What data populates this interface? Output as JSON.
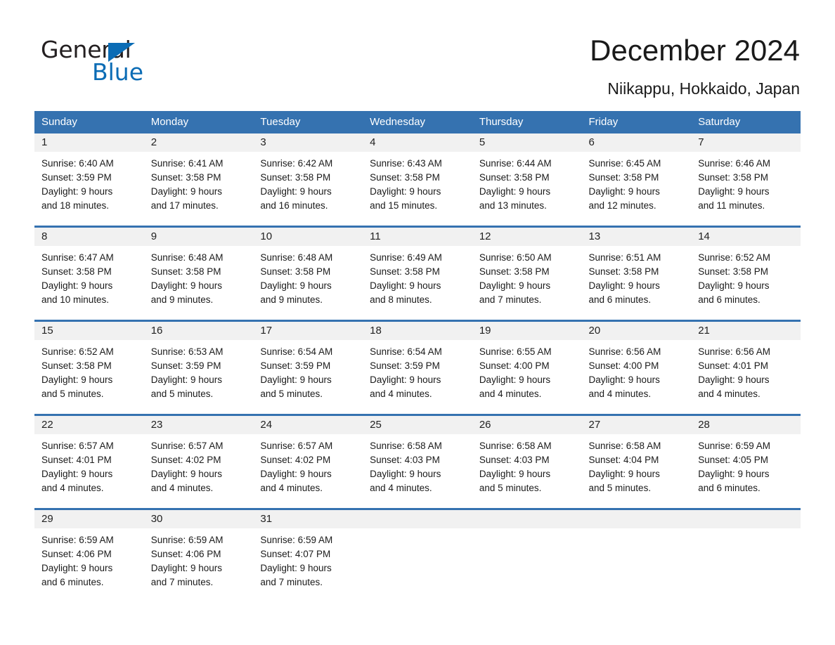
{
  "brand": {
    "name_part1": "General",
    "name_part2": "Blue",
    "triangle_icon": "blue-triangle-icon",
    "accent_color": "#0b6cb5"
  },
  "header": {
    "title": "December 2024",
    "subtitle": "Niikappu, Hokkaido, Japan"
  },
  "theme": {
    "header_blue": "#3572b0",
    "daynum_band_gray": "#f1f1f1",
    "text": "#1a1a1a"
  },
  "calendar": {
    "weekday_headers": [
      "Sunday",
      "Monday",
      "Tuesday",
      "Wednesday",
      "Thursday",
      "Friday",
      "Saturday"
    ],
    "weeks": [
      [
        {
          "day": "1",
          "sunrise": "Sunrise: 6:40 AM",
          "sunset": "Sunset: 3:59 PM",
          "daylight_line1": "Daylight: 9 hours",
          "daylight_line2": "and 18 minutes."
        },
        {
          "day": "2",
          "sunrise": "Sunrise: 6:41 AM",
          "sunset": "Sunset: 3:58 PM",
          "daylight_line1": "Daylight: 9 hours",
          "daylight_line2": "and 17 minutes."
        },
        {
          "day": "3",
          "sunrise": "Sunrise: 6:42 AM",
          "sunset": "Sunset: 3:58 PM",
          "daylight_line1": "Daylight: 9 hours",
          "daylight_line2": "and 16 minutes."
        },
        {
          "day": "4",
          "sunrise": "Sunrise: 6:43 AM",
          "sunset": "Sunset: 3:58 PM",
          "daylight_line1": "Daylight: 9 hours",
          "daylight_line2": "and 15 minutes."
        },
        {
          "day": "5",
          "sunrise": "Sunrise: 6:44 AM",
          "sunset": "Sunset: 3:58 PM",
          "daylight_line1": "Daylight: 9 hours",
          "daylight_line2": "and 13 minutes."
        },
        {
          "day": "6",
          "sunrise": "Sunrise: 6:45 AM",
          "sunset": "Sunset: 3:58 PM",
          "daylight_line1": "Daylight: 9 hours",
          "daylight_line2": "and 12 minutes."
        },
        {
          "day": "7",
          "sunrise": "Sunrise: 6:46 AM",
          "sunset": "Sunset: 3:58 PM",
          "daylight_line1": "Daylight: 9 hours",
          "daylight_line2": "and 11 minutes."
        }
      ],
      [
        {
          "day": "8",
          "sunrise": "Sunrise: 6:47 AM",
          "sunset": "Sunset: 3:58 PM",
          "daylight_line1": "Daylight: 9 hours",
          "daylight_line2": "and 10 minutes."
        },
        {
          "day": "9",
          "sunrise": "Sunrise: 6:48 AM",
          "sunset": "Sunset: 3:58 PM",
          "daylight_line1": "Daylight: 9 hours",
          "daylight_line2": "and 9 minutes."
        },
        {
          "day": "10",
          "sunrise": "Sunrise: 6:48 AM",
          "sunset": "Sunset: 3:58 PM",
          "daylight_line1": "Daylight: 9 hours",
          "daylight_line2": "and 9 minutes."
        },
        {
          "day": "11",
          "sunrise": "Sunrise: 6:49 AM",
          "sunset": "Sunset: 3:58 PM",
          "daylight_line1": "Daylight: 9 hours",
          "daylight_line2": "and 8 minutes."
        },
        {
          "day": "12",
          "sunrise": "Sunrise: 6:50 AM",
          "sunset": "Sunset: 3:58 PM",
          "daylight_line1": "Daylight: 9 hours",
          "daylight_line2": "and 7 minutes."
        },
        {
          "day": "13",
          "sunrise": "Sunrise: 6:51 AM",
          "sunset": "Sunset: 3:58 PM",
          "daylight_line1": "Daylight: 9 hours",
          "daylight_line2": "and 6 minutes."
        },
        {
          "day": "14",
          "sunrise": "Sunrise: 6:52 AM",
          "sunset": "Sunset: 3:58 PM",
          "daylight_line1": "Daylight: 9 hours",
          "daylight_line2": "and 6 minutes."
        }
      ],
      [
        {
          "day": "15",
          "sunrise": "Sunrise: 6:52 AM",
          "sunset": "Sunset: 3:58 PM",
          "daylight_line1": "Daylight: 9 hours",
          "daylight_line2": "and 5 minutes."
        },
        {
          "day": "16",
          "sunrise": "Sunrise: 6:53 AM",
          "sunset": "Sunset: 3:59 PM",
          "daylight_line1": "Daylight: 9 hours",
          "daylight_line2": "and 5 minutes."
        },
        {
          "day": "17",
          "sunrise": "Sunrise: 6:54 AM",
          "sunset": "Sunset: 3:59 PM",
          "daylight_line1": "Daylight: 9 hours",
          "daylight_line2": "and 5 minutes."
        },
        {
          "day": "18",
          "sunrise": "Sunrise: 6:54 AM",
          "sunset": "Sunset: 3:59 PM",
          "daylight_line1": "Daylight: 9 hours",
          "daylight_line2": "and 4 minutes."
        },
        {
          "day": "19",
          "sunrise": "Sunrise: 6:55 AM",
          "sunset": "Sunset: 4:00 PM",
          "daylight_line1": "Daylight: 9 hours",
          "daylight_line2": "and 4 minutes."
        },
        {
          "day": "20",
          "sunrise": "Sunrise: 6:56 AM",
          "sunset": "Sunset: 4:00 PM",
          "daylight_line1": "Daylight: 9 hours",
          "daylight_line2": "and 4 minutes."
        },
        {
          "day": "21",
          "sunrise": "Sunrise: 6:56 AM",
          "sunset": "Sunset: 4:01 PM",
          "daylight_line1": "Daylight: 9 hours",
          "daylight_line2": "and 4 minutes."
        }
      ],
      [
        {
          "day": "22",
          "sunrise": "Sunrise: 6:57 AM",
          "sunset": "Sunset: 4:01 PM",
          "daylight_line1": "Daylight: 9 hours",
          "daylight_line2": "and 4 minutes."
        },
        {
          "day": "23",
          "sunrise": "Sunrise: 6:57 AM",
          "sunset": "Sunset: 4:02 PM",
          "daylight_line1": "Daylight: 9 hours",
          "daylight_line2": "and 4 minutes."
        },
        {
          "day": "24",
          "sunrise": "Sunrise: 6:57 AM",
          "sunset": "Sunset: 4:02 PM",
          "daylight_line1": "Daylight: 9 hours",
          "daylight_line2": "and 4 minutes."
        },
        {
          "day": "25",
          "sunrise": "Sunrise: 6:58 AM",
          "sunset": "Sunset: 4:03 PM",
          "daylight_line1": "Daylight: 9 hours",
          "daylight_line2": "and 4 minutes."
        },
        {
          "day": "26",
          "sunrise": "Sunrise: 6:58 AM",
          "sunset": "Sunset: 4:03 PM",
          "daylight_line1": "Daylight: 9 hours",
          "daylight_line2": "and 5 minutes."
        },
        {
          "day": "27",
          "sunrise": "Sunrise: 6:58 AM",
          "sunset": "Sunset: 4:04 PM",
          "daylight_line1": "Daylight: 9 hours",
          "daylight_line2": "and 5 minutes."
        },
        {
          "day": "28",
          "sunrise": "Sunrise: 6:59 AM",
          "sunset": "Sunset: 4:05 PM",
          "daylight_line1": "Daylight: 9 hours",
          "daylight_line2": "and 6 minutes."
        }
      ],
      [
        {
          "day": "29",
          "sunrise": "Sunrise: 6:59 AM",
          "sunset": "Sunset: 4:06 PM",
          "daylight_line1": "Daylight: 9 hours",
          "daylight_line2": "and 6 minutes."
        },
        {
          "day": "30",
          "sunrise": "Sunrise: 6:59 AM",
          "sunset": "Sunset: 4:06 PM",
          "daylight_line1": "Daylight: 9 hours",
          "daylight_line2": "and 7 minutes."
        },
        {
          "day": "31",
          "sunrise": "Sunrise: 6:59 AM",
          "sunset": "Sunset: 4:07 PM",
          "daylight_line1": "Daylight: 9 hours",
          "daylight_line2": "and 7 minutes."
        },
        {
          "day": "",
          "sunrise": "",
          "sunset": "",
          "daylight_line1": "",
          "daylight_line2": ""
        },
        {
          "day": "",
          "sunrise": "",
          "sunset": "",
          "daylight_line1": "",
          "daylight_line2": ""
        },
        {
          "day": "",
          "sunrise": "",
          "sunset": "",
          "daylight_line1": "",
          "daylight_line2": ""
        },
        {
          "day": "",
          "sunrise": "",
          "sunset": "",
          "daylight_line1": "",
          "daylight_line2": ""
        }
      ]
    ]
  }
}
